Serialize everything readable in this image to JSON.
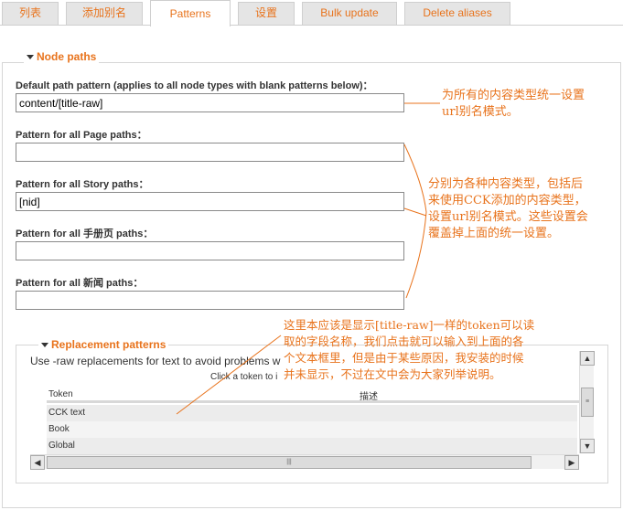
{
  "tabs": [
    {
      "label": "列表"
    },
    {
      "label": "添加别名"
    },
    {
      "label": "Patterns"
    },
    {
      "label": "设置"
    },
    {
      "label": "Bulk update"
    },
    {
      "label": "Delete aliases"
    }
  ],
  "node_paths": {
    "legend": "Node paths",
    "default_label": "Default path pattern (applies to all node types with blank patterns below)：",
    "default_value": "content/[title-raw]",
    "page_label": "Pattern for all Page paths：",
    "page_value": "",
    "story_label": "Pattern for all Story paths：",
    "story_value": "[nid]",
    "manual_label": "Pattern for all 手册页  paths：",
    "manual_value": "",
    "news_label": "Pattern for all 新闻  paths：",
    "news_value": ""
  },
  "replacement": {
    "legend": "Replacement patterns",
    "description": "Use -raw replacements for text to avoid problems w",
    "click_hint": "Click a token to i",
    "col_token": "Token",
    "col_desc": "描述",
    "rows": [
      "CCK text",
      "Book",
      "Global"
    ]
  },
  "annotations": {
    "note1": [
      "为所有的内容类型统一设置",
      "url别名模式。"
    ],
    "note2": [
      "分别为各种内容类型，包括后",
      "来使用CCK添加的内容类型，",
      "设置url别名模式。这些设置会",
      "覆盖掉上面的统一设置。"
    ],
    "note3": [
      "这里本应该是显示[title-raw]一样的token可以读",
      "取的字段名称，我们点击就可以输入到上面的各",
      "个文本框里，但是由于某些原因，我安装的时候",
      "并未显示，不过在文中会为大家列举说明。"
    ]
  },
  "colors": {
    "accent": "#e8731c",
    "tab_bg": "#e5e5e5",
    "border": "#cfcfcf"
  },
  "scroll_glyphs": {
    "up": "▲",
    "down": "▼",
    "left": "◀",
    "right": "▶",
    "grip_v": "≡",
    "grip_h": "|||"
  }
}
